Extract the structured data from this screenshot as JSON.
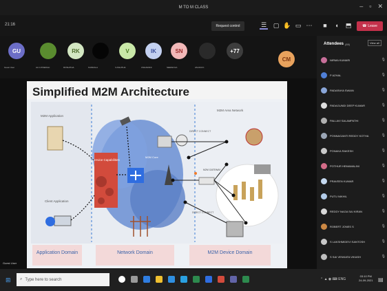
{
  "window": {
    "title": "M TO M CLASS"
  },
  "toolbar": {
    "meeting_time": "21:16",
    "request_control_label": "Request control",
    "leave_label": "Leave"
  },
  "participants_strip": {
    "tiles": [
      {
        "initials": "GU",
        "label": "Guest User",
        "bg": "#6c6ec7",
        "fg": "#ffffff"
      },
      {
        "initials": "",
        "label": "ALI HYDERALI",
        "bg": "#5a8c2f",
        "fg": "#ffffff"
      },
      {
        "initials": "RK",
        "label": "ROSHITHA",
        "bg": "#d3e7c2",
        "fg": "#4b6a2a"
      },
      {
        "initials": "",
        "label": "KANDALA",
        "bg": "#050505",
        "fg": "#ffffff"
      },
      {
        "initials": "V",
        "label": "V.ASHITHA",
        "bg": "#c9e8a8",
        "fg": "#4b7a23"
      },
      {
        "initials": "IK",
        "label": "USHARANI",
        "bg": "#c3d0f0",
        "fg": "#3a4f9a"
      },
      {
        "initials": "SN",
        "label": "SEEMA NA",
        "bg": "#f2b8b8",
        "fg": "#9b2c2c"
      },
      {
        "initials": "",
        "label": "ANJANI K",
        "bg": "#2a2a2a",
        "fg": "#ffffff"
      },
      {
        "initials": "+77",
        "label": "",
        "bg": "#3d3d3d",
        "fg": "#ffffff"
      }
    ],
    "host_initials": "CM"
  },
  "slide": {
    "title": "Simplified M2M Architecture",
    "labels": {
      "m2m_application": "M2M Application",
      "client_application": "Client Application",
      "service_capabilities": "Service Capabilities",
      "m2m_core": "M2M Core",
      "m2m_area_network": "M2M Area Network",
      "direct_connect_top": "DIRECT CONNECT",
      "direct_connect_bottom": "DIRECT CONNECT",
      "m2m_gateway": "M2M GATEWAY",
      "application_domain": "Application Domain",
      "network_domain": "Network Domain",
      "device_domain": "M2M Device Domain"
    }
  },
  "presenter_name": "Guest User",
  "attendees_panel": {
    "title": "Attendees",
    "count": "(89)",
    "view_all": "View all",
    "people": [
      {
        "name": "NIRMA KUMARI",
        "color": "#c86f9a"
      },
      {
        "name": "P AZHAL",
        "color": "#4f7fd6"
      },
      {
        "name": "PADARAYA SWAIN",
        "color": "#8aa6d8"
      },
      {
        "name": "PADAGUNDI DEEP KUMAR",
        "color": "#dddddd"
      },
      {
        "name": "PALLAVI SALAMPATHI",
        "color": "#b0b0b0"
      },
      {
        "name": "PONNAGANTI REDDY KOTHA",
        "color": "#9aa5b5"
      },
      {
        "name": "PONAKA RAKESH",
        "color": "#c9c9c9"
      },
      {
        "name": "POTHUR HEMAMALINI",
        "color": "#d36b87"
      },
      {
        "name": "PRAVEEN KUMAR",
        "color": "#c5d9f0"
      },
      {
        "name": "PUTU NIKHIL",
        "color": "#b2cbe8"
      },
      {
        "name": "REDDY NAGA SAI KIRAN",
        "color": "#d8d8d8"
      },
      {
        "name": "ROBERT JONES S",
        "color": "#cc8844"
      },
      {
        "name": "S LAKSHMIDEVI SANTOSH",
        "color": "#c8c8c8"
      },
      {
        "name": "S SAI VENKATA VIKASH",
        "color": "#bebebe"
      }
    ]
  },
  "taskbar": {
    "search_placeholder": "Type here to search",
    "time": "03:10 PM",
    "date": "24-09-2021"
  }
}
